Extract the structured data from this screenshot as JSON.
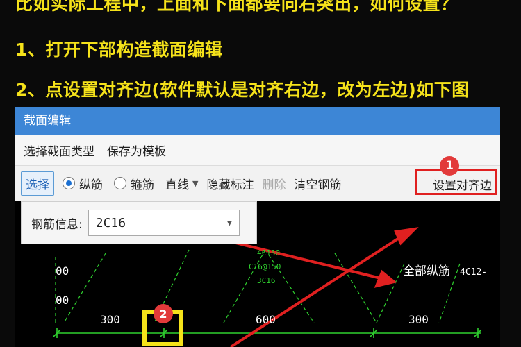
{
  "captions": [
    "比如实际工程中，上面和下面都要向右突出，如何设置？",
    "1、打开下部构造截面编辑",
    "2、点设置对齐边(软件默认是对齐右边，改为左边)如下图"
  ],
  "window": {
    "title": "截面编辑",
    "menu": [
      "选择截面类型",
      "保存为模板"
    ],
    "toolbar": {
      "select": "选择",
      "radio_long": "纵筋",
      "radio_stirrup": "箍筋",
      "line": "直线",
      "hide_labels": "隐藏标注",
      "delete": "删除",
      "clear": "清空钢筋",
      "align": "设置对齐边"
    },
    "markers": {
      "one": "1",
      "two": "2"
    },
    "info": {
      "label": "钢筋信息:",
      "value": "2C16"
    },
    "canvas": {
      "dim_left": "300",
      "dim_mid": "600",
      "dim_right": "300",
      "all_bars": "全部纵筋",
      "bar_spec": "4C12-",
      "ann1": "4C150",
      "ann2": "C16@150",
      "ann3": "3C16",
      "ann4": "00",
      "ann5": "00"
    }
  },
  "colors": {
    "caption": "#f5e21a",
    "title_bar": "#3d86d6",
    "highlight": "#e02020",
    "cad_green": "#2fd12f",
    "marker_fill": "#e23a3a"
  }
}
